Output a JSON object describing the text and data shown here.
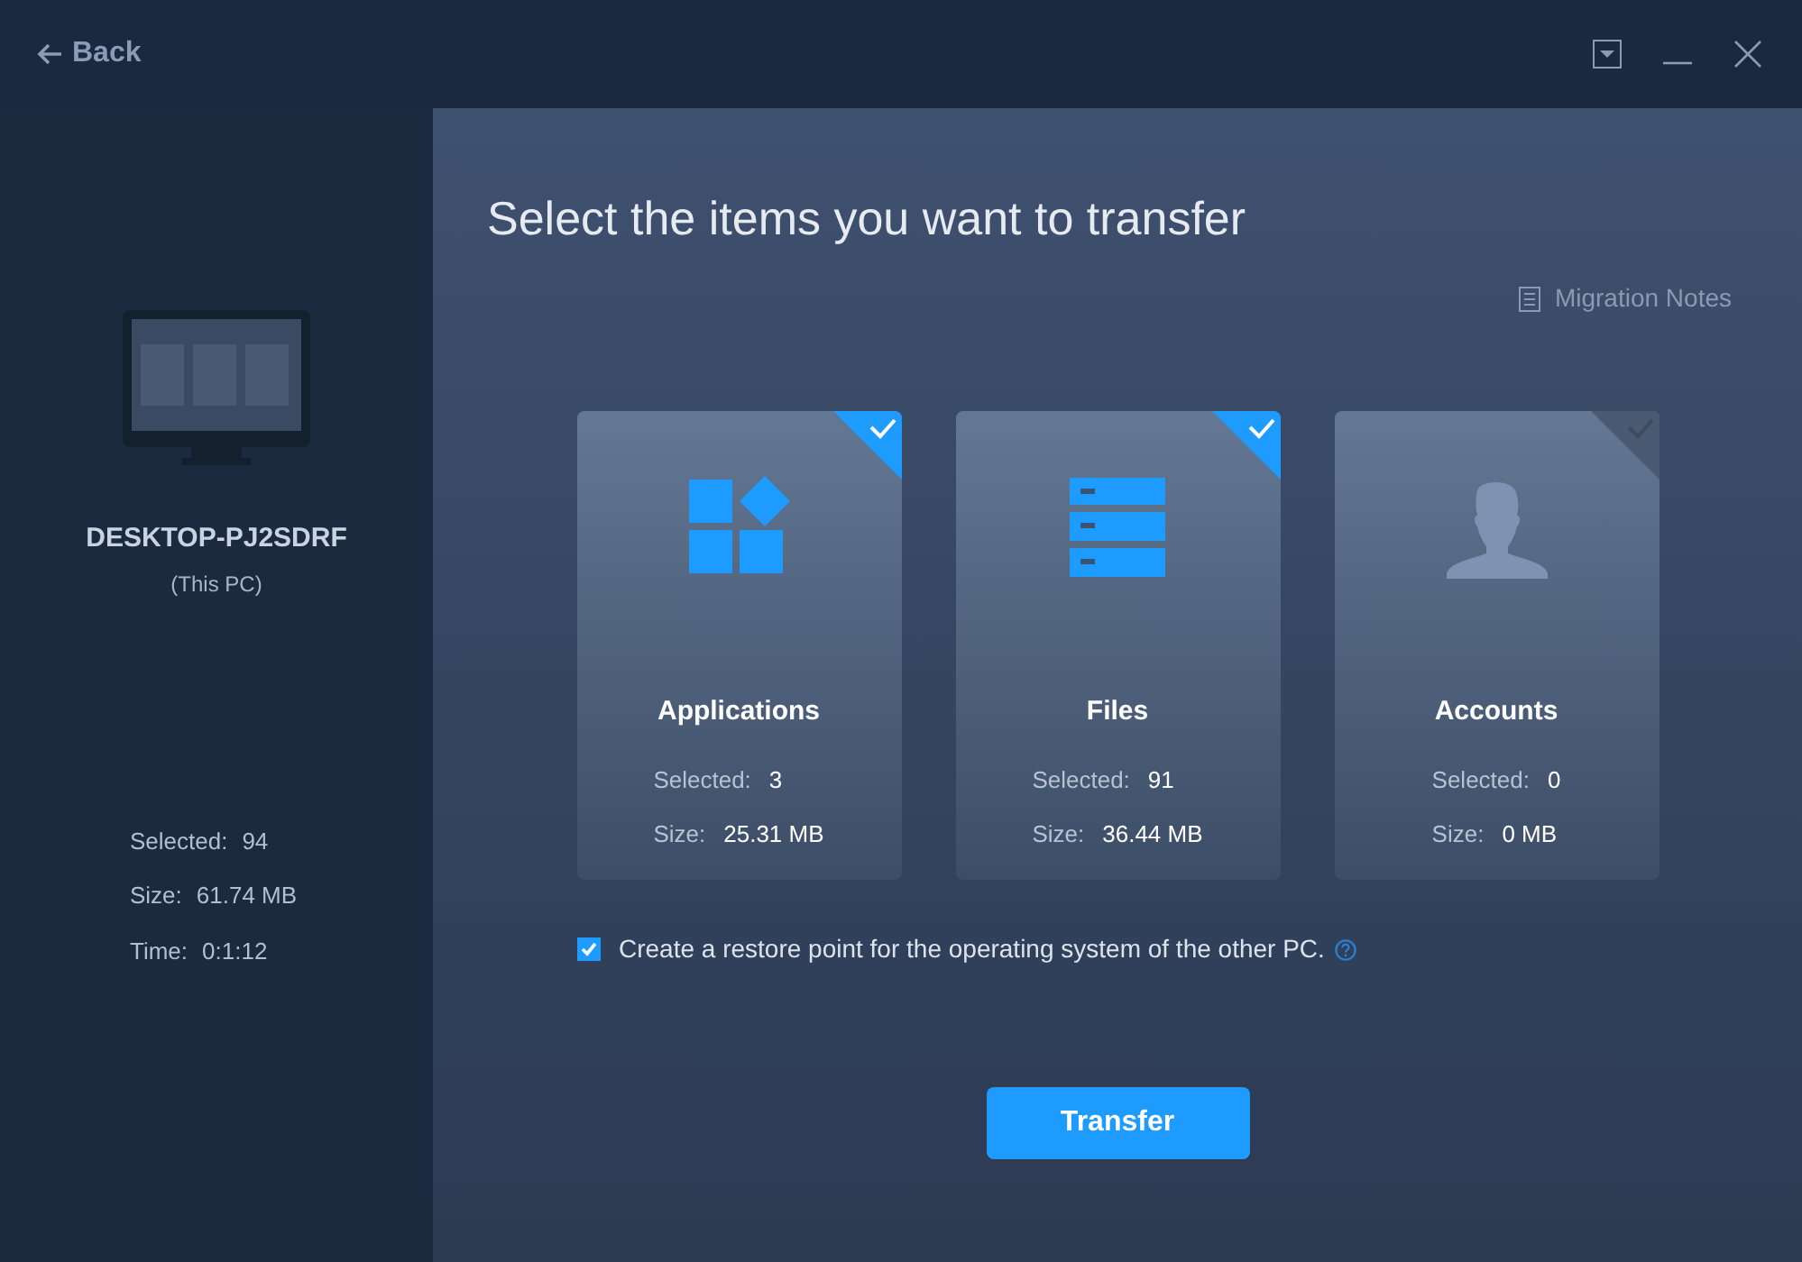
{
  "title_bar": {
    "back_label": "Back"
  },
  "source_pc": {
    "name": "DESKTOP-PJ2SDRF",
    "note": "(This PC)",
    "stats": [
      {
        "label": "Selected:",
        "value": "94"
      },
      {
        "label": "Size:",
        "value": "61.74 MB"
      },
      {
        "label": "Time:",
        "value": "0:1:12"
      }
    ]
  },
  "main": {
    "heading": "Select the items you want to transfer",
    "notes_link": "Migration Notes",
    "categories": [
      {
        "kind": "apps",
        "name": "Applications",
        "selected": true,
        "selected_label": "Selected:",
        "selected_count": "3",
        "size_label": "Size:",
        "size": "25.31 MB"
      },
      {
        "kind": "files",
        "name": "Files",
        "selected": true,
        "selected_label": "Selected:",
        "selected_count": "91",
        "size_label": "Size:",
        "size": "36.44 MB"
      },
      {
        "kind": "accounts",
        "name": "Accounts",
        "selected": false,
        "selected_label": "Selected:",
        "selected_count": "0",
        "size_label": "Size:",
        "size": "0 MB"
      }
    ],
    "restore_point": {
      "label": "Create a restore point for the operating system of the other PC.",
      "checked": true
    },
    "transfer_button": "Transfer"
  }
}
